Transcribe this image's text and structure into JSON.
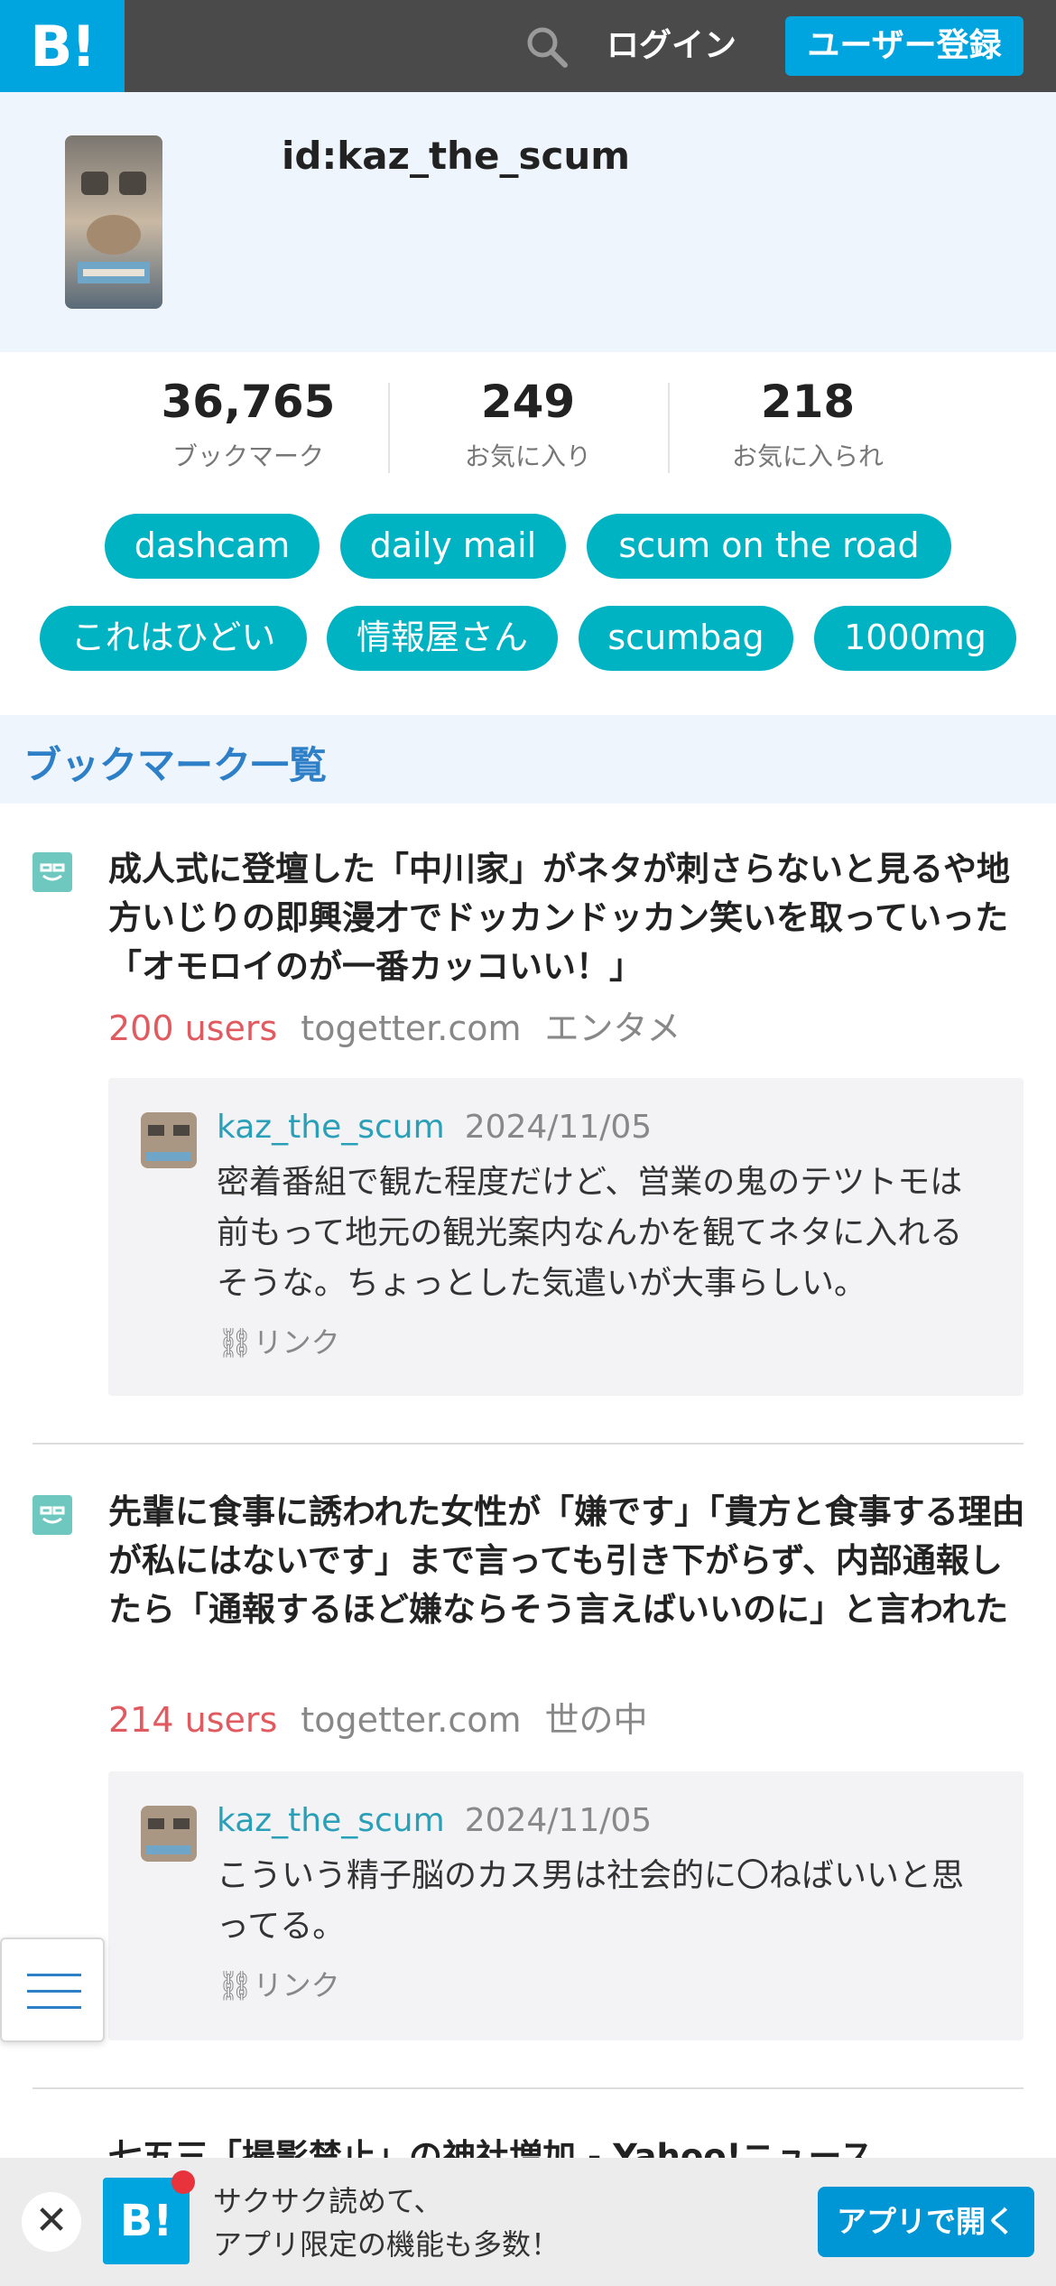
{
  "header": {
    "logo": "B!",
    "login_label": "ログイン",
    "signup_label": "ユーザー登録"
  },
  "profile": {
    "user_id": "id:kaz_the_scum"
  },
  "stats": [
    {
      "value": "36,765",
      "label": "ブックマーク"
    },
    {
      "value": "249",
      "label": "お気に入り"
    },
    {
      "value": "218",
      "label": "お気に入られ"
    }
  ],
  "tags": [
    "dashcam",
    "daily mail",
    "scum on the road",
    "これはひどい",
    "情報屋さん",
    "scumbag",
    "1000mg"
  ],
  "section": {
    "title": "ブックマーク一覧"
  },
  "entries": [
    {
      "title": "成人式に登壇した「中川家」がネタが刺さらないと見るや地方いじりの即興漫才でドッカンドッカン笑いを取っていった「オモロイのが一番カッコいい！」",
      "users": "200 users",
      "domain": "togetter.com",
      "category": "エンタメ",
      "comment_user": "kaz_the_scum",
      "comment_date": "2024/11/05",
      "comment_text": "密着番組で観た程度だけど、営業の鬼のテツトモは前もって地元の観光案内なんかを観てネタに入れるそうな。ちょっとした気遣いが大事らしい。",
      "link_label": "リンク"
    },
    {
      "title": "先輩に食事に誘われた女性が「嫌です」「貴方と食事する理由が私にはないです」まで言っても引き下がらず、内部通報したら「通報するほど嫌ならそう言えばいいのに」と言われた",
      "users": "214 users",
      "domain": "togetter.com",
      "category": "世の中",
      "comment_user": "kaz_the_scum",
      "comment_date": "2024/11/05",
      "comment_text": "こういう精子脳のカス男は社会的に〇ねばいいと思ってる。",
      "link_label": "リンク"
    },
    {
      "title": "七五三「撮影禁止」の神社増加 - Yahoo!ニュース"
    }
  ],
  "banner": {
    "close": "✕",
    "logo": "B!",
    "line1": "サクサク読めて、",
    "line2": "アプリ限定の機能も多数！",
    "open_label": "アプリで開く"
  },
  "colors": {
    "header_bg": "#4a4a4a",
    "brand_blue": "#00a4de",
    "tag_bg": "#00b3c2",
    "users_red": "#e05a60",
    "section_blue": "#2d7fc8"
  }
}
